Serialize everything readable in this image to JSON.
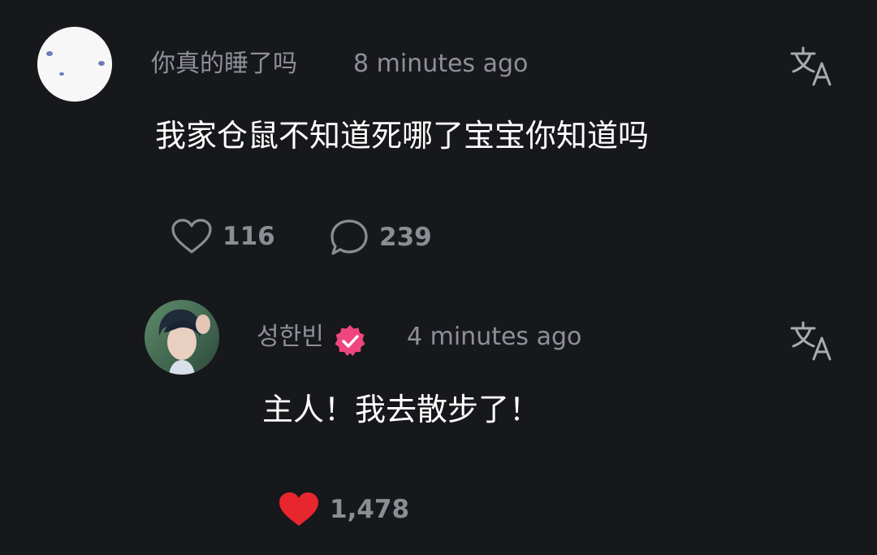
{
  "comment": {
    "username": "你真的睡了吗",
    "timestamp": "8 minutes ago",
    "text": "我家仓鼠不知道死哪了宝宝你知道吗",
    "likes": "116",
    "replies": "239",
    "liked": false
  },
  "reply": {
    "username": "성한빈",
    "verified": true,
    "timestamp": "4 minutes ago",
    "text": "主人！我去散步了！",
    "likes": "1,478",
    "liked": true
  },
  "icons": {
    "translate": "translate-icon",
    "heart": "heart-icon",
    "comment": "comment-bubble-icon",
    "verified": "verified-badge-icon"
  },
  "colors": {
    "background": "#17181b",
    "muted_text": "#8f8f99",
    "like_red": "#e8262e",
    "verified_pink": "#f0467f"
  }
}
